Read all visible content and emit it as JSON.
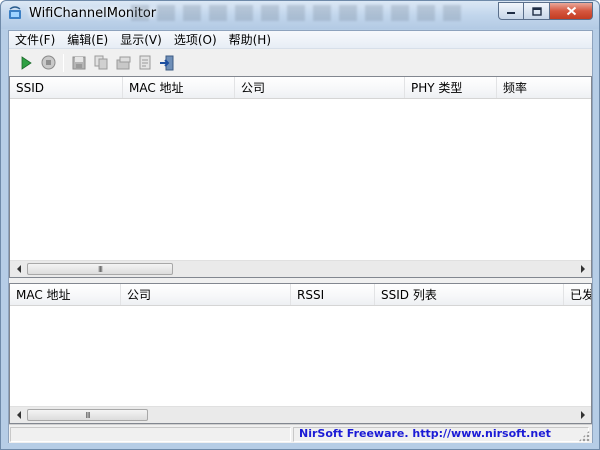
{
  "window": {
    "title": "WifiChannelMonitor",
    "colors": {
      "titlebar": "#c2d6ec",
      "close_button": "#d5573f"
    }
  },
  "menu": [
    "文件(F)",
    "编辑(E)",
    "显示(V)",
    "选项(O)",
    "帮助(H)"
  ],
  "toolbar": {
    "buttons": [
      {
        "name": "start-capture",
        "icon": "play-icon",
        "color": "#2ea043"
      },
      {
        "name": "stop-capture",
        "icon": "stop-icon"
      },
      {
        "name": "save",
        "icon": "save-icon"
      },
      {
        "name": "copy",
        "icon": "copy-icon"
      },
      {
        "name": "properties",
        "icon": "properties-icon"
      },
      {
        "name": "html-report",
        "icon": "report-icon"
      },
      {
        "name": "exit",
        "icon": "exit-icon"
      }
    ]
  },
  "top_list": {
    "columns": [
      "SSID",
      "MAC 地址",
      "公司",
      "PHY 类型",
      "频率"
    ]
  },
  "bottom_list": {
    "columns": [
      "MAC 地址",
      "公司",
      "RSSI",
      "SSID 列表",
      "已发"
    ]
  },
  "scroll_grip": "III",
  "status": {
    "link_text": "NirSoft Freeware.  http://www.nirsoft.net"
  }
}
